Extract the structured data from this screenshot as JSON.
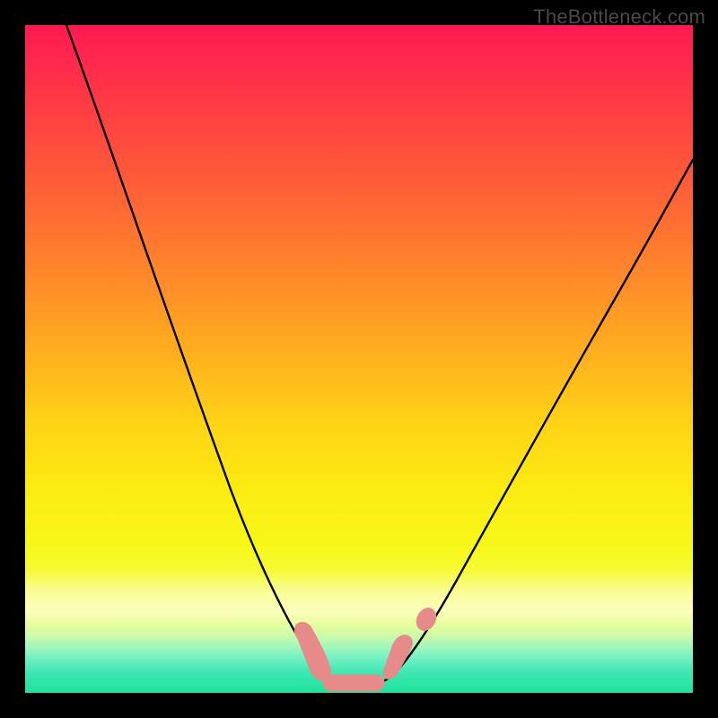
{
  "watermark": {
    "text": "TheBottleneck.com"
  },
  "chart_data": {
    "type": "line",
    "title": "",
    "xlabel": "",
    "ylabel": "",
    "xlim": [
      0,
      100
    ],
    "ylim": [
      0,
      100
    ],
    "grid": false,
    "legend": false,
    "background_gradient": {
      "direction": "top-to-bottom",
      "stops": [
        {
          "pos": 0,
          "color": "#ff1a52"
        },
        {
          "pos": 50,
          "color": "#ffb21e"
        },
        {
          "pos": 80,
          "color": "#f7f81a"
        },
        {
          "pos": 100,
          "color": "#1fe29b"
        }
      ]
    },
    "series": [
      {
        "name": "bottleneck-curve",
        "color": "#000000",
        "x": [
          6,
          10,
          14,
          18,
          22,
          26,
          30,
          34,
          37,
          39,
          41,
          43,
          45,
          48,
          51,
          54,
          58,
          63,
          69,
          76,
          84,
          92,
          100
        ],
        "y": [
          100,
          88,
          76,
          64,
          53,
          42,
          32,
          23,
          16,
          11,
          7,
          4,
          2,
          1,
          1,
          2,
          5,
          10,
          18,
          29,
          42,
          56,
          71
        ]
      }
    ],
    "annotations": [
      {
        "name": "valley-marker",
        "shape": "rounded-blob",
        "color": "#e78a8a",
        "approx_x_range": [
          41,
          55
        ],
        "approx_y_range": [
          0,
          7
        ]
      }
    ]
  }
}
